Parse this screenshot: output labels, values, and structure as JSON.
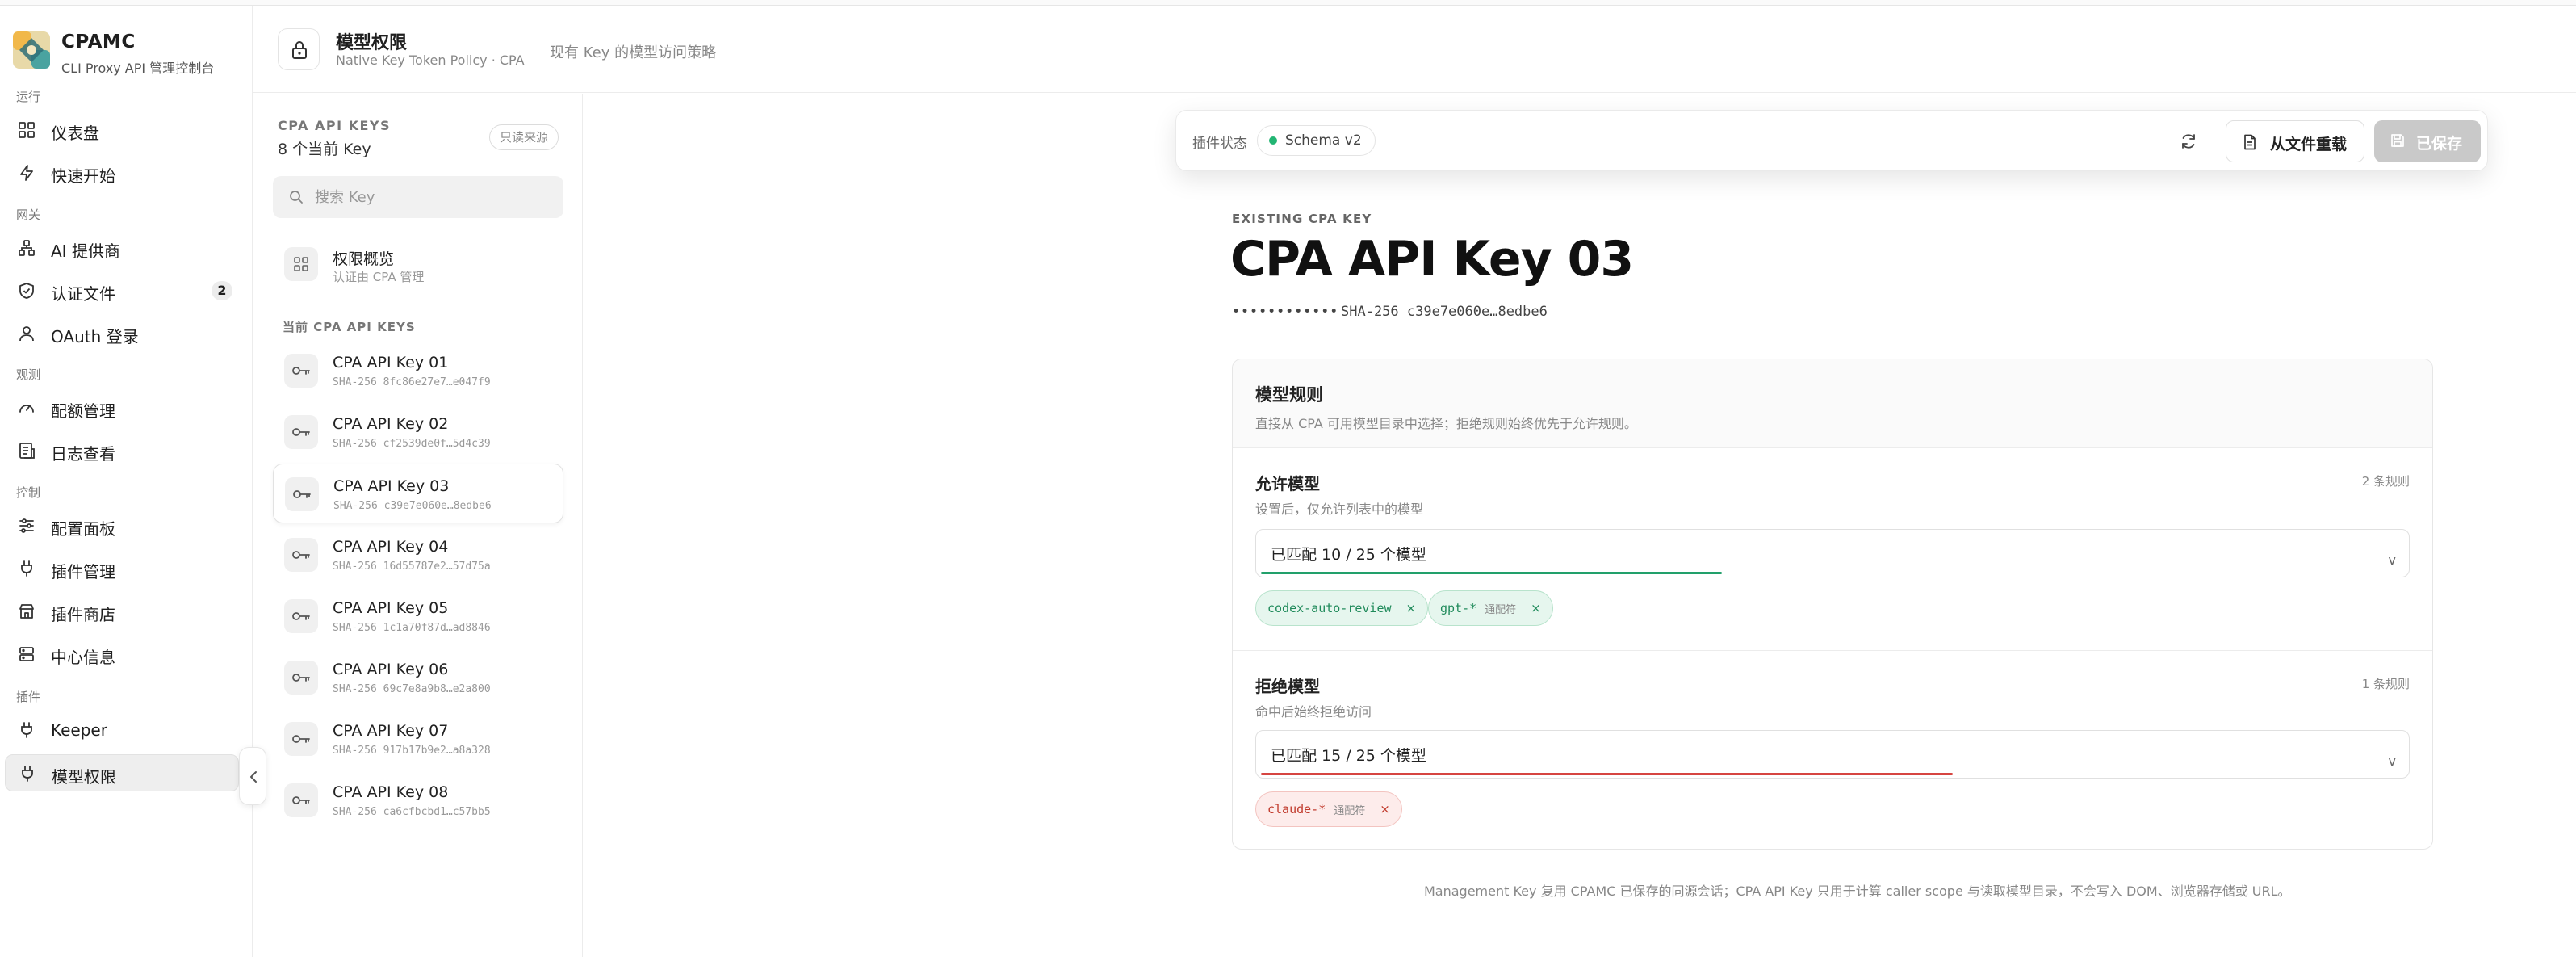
{
  "brand": {
    "name": "CPAMC",
    "subtitle": "CLI Proxy API 管理控制台"
  },
  "sidebar": {
    "groups": [
      {
        "label": "运行"
      },
      {
        "label": "网关"
      },
      {
        "label": "观测"
      },
      {
        "label": "控制"
      },
      {
        "label": "插件"
      }
    ],
    "items": [
      {
        "label": "仪表盘",
        "icon": "dashboard-icon"
      },
      {
        "label": "快速开始",
        "icon": "bolt-icon"
      },
      {
        "label": "AI 提供商",
        "icon": "network-icon"
      },
      {
        "label": "认证文件",
        "icon": "shield-icon",
        "badge": "2"
      },
      {
        "label": "OAuth 登录",
        "icon": "user-icon"
      },
      {
        "label": "配额管理",
        "icon": "gauge-icon"
      },
      {
        "label": "日志查看",
        "icon": "log-icon"
      },
      {
        "label": "配置面板",
        "icon": "sliders-icon"
      },
      {
        "label": "插件管理",
        "icon": "plug-icon"
      },
      {
        "label": "插件商店",
        "icon": "store-icon"
      },
      {
        "label": "中心信息",
        "icon": "server-icon"
      },
      {
        "label": "Keeper",
        "icon": "plug-icon"
      },
      {
        "label": "模型权限",
        "icon": "plug-icon",
        "active": true
      }
    ]
  },
  "header": {
    "title": "模型权限",
    "subtitle": "Native Key Token Policy · CPA",
    "description": "现有 Key 的模型访问策略"
  },
  "keys_panel": {
    "label": "CPA API KEYS",
    "count": "8 个当前 Key",
    "readonly_badge": "只读来源",
    "search_placeholder": "搜索 Key",
    "overview": {
      "title": "权限概览",
      "subtitle": "认证由 CPA 管理"
    },
    "section_label": "当前 CPA API KEYS",
    "keys": [
      {
        "name": "CPA API Key 01",
        "hash": "SHA-256 8fc86e27e7…e047f9"
      },
      {
        "name": "CPA API Key 02",
        "hash": "SHA-256 cf2539de0f…5d4c39"
      },
      {
        "name": "CPA API Key 03",
        "hash": "SHA-256 c39e7e060e…8edbe6",
        "active": true
      },
      {
        "name": "CPA API Key 04",
        "hash": "SHA-256 16d55787e2…57d75a"
      },
      {
        "name": "CPA API Key 05",
        "hash": "SHA-256 1c1a70f87d…ad8846"
      },
      {
        "name": "CPA API Key 06",
        "hash": "SHA-256 69c7e8a9b8…e2a800"
      },
      {
        "name": "CPA API Key 07",
        "hash": "SHA-256 917b17b9e2…a8a328"
      },
      {
        "name": "CPA API Key 08",
        "hash": "SHA-256 ca6cfbcbd1…c57bb5"
      }
    ]
  },
  "toolbar": {
    "status_label": "插件状态",
    "schema": "Schema v2",
    "reload_label": "从文件重载",
    "save_label": "已保存",
    "colors": {
      "status_dot": "#22b573",
      "save_bg": "#c9c9c9"
    }
  },
  "detail": {
    "eyebrow": "EXISTING CPA KEY",
    "title": "CPA API Key 03",
    "mask": "••••••••••••",
    "sha": "SHA-256 c39e7e060e…8edbe6"
  },
  "rules": {
    "title": "模型规则",
    "subtitle": "直接从 CPA 可用模型目录中选择；拒绝规则始终优先于允许规则。",
    "allow": {
      "title": "允许模型",
      "subtitle": "设置后，仅允许列表中的模型",
      "count": "2 条规则",
      "select_value": "已匹配 10 / 25 个模型",
      "progress": 0.4,
      "color": "#22a06b",
      "chips": [
        {
          "text": "codex-auto-review",
          "wildcard": ""
        },
        {
          "text": "gpt-*",
          "wildcard": "通配符"
        }
      ]
    },
    "deny": {
      "title": "拒绝模型",
      "subtitle": "命中后始终拒绝访问",
      "count": "1 条规则",
      "select_value": "已匹配 15 / 25 个模型",
      "progress": 0.6,
      "color": "#d64541",
      "chips": [
        {
          "text": "claude-*",
          "wildcard": "通配符"
        }
      ]
    }
  },
  "footer_note": "Management Key 复用 CPAMC 已保存的同源会话；CPA API Key 只用于计算 caller scope 与读取模型目录，不会写入 DOM、浏览器存储或 URL。",
  "chevron": "v",
  "close_glyph": "×"
}
